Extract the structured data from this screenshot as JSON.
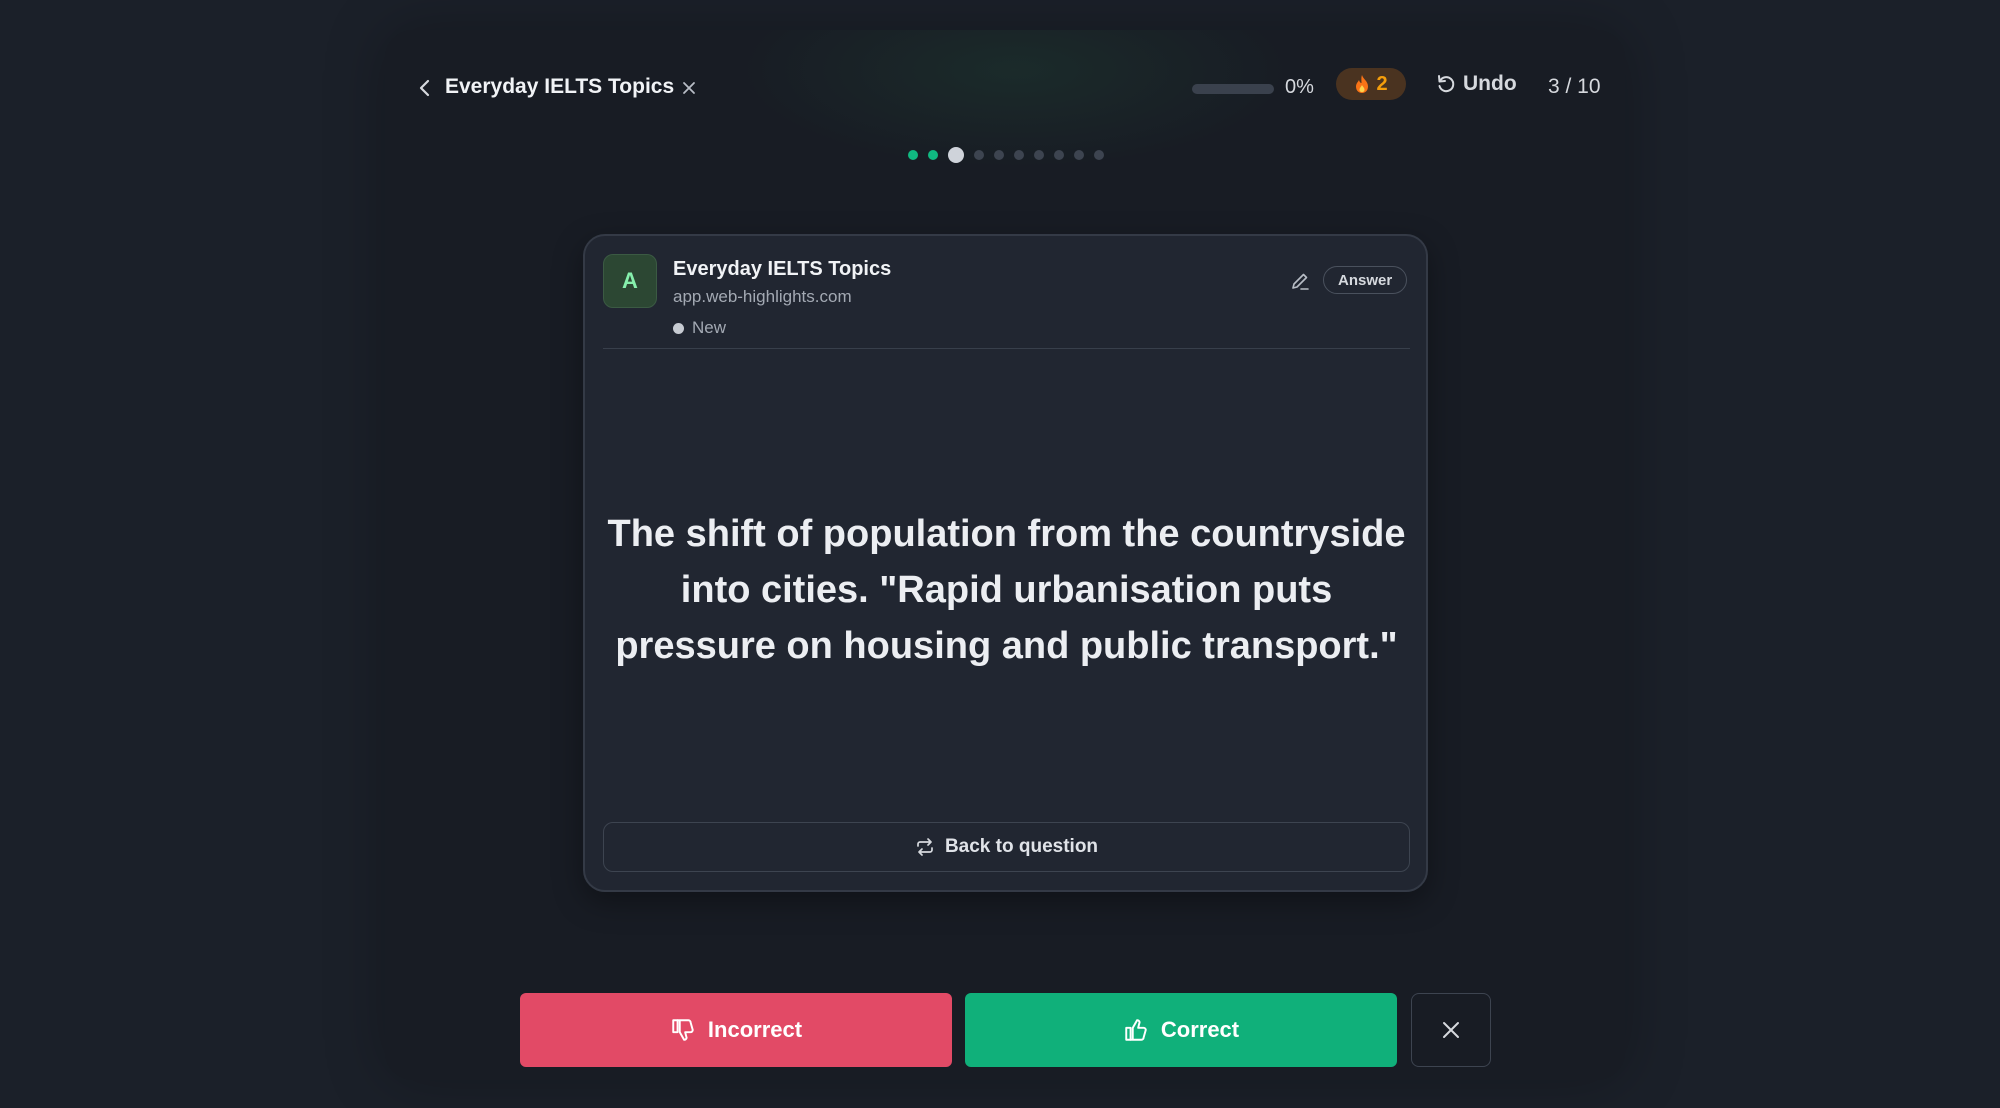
{
  "header": {
    "title": "Everyday IELTS Topics",
    "progress_value": 0,
    "progress_label": "0%",
    "streak_count": "2",
    "undo_label": "Undo",
    "counter": "3 / 10"
  },
  "progress_dots": {
    "total": 10,
    "done": 2,
    "current_index": 2
  },
  "card": {
    "avatar_letter": "A",
    "source_title": "Everyday IELTS Topics",
    "source_url": "app.web-highlights.com",
    "status": "New",
    "side_badge": "Answer",
    "text": "The shift of population from the countryside into cities. \"Rapid urbanisation puts pressure on housing and public transport.\"",
    "flip_label": "Back to question"
  },
  "actions": {
    "incorrect_label": "Incorrect",
    "correct_label": "Correct"
  },
  "colors": {
    "incorrect": "#e24a66",
    "correct": "#10b07a",
    "progress_accent": "#10b981",
    "streak": "#f59e0b"
  },
  "icons": [
    "chevron-left-icon",
    "close-icon",
    "flame-icon",
    "undo-icon",
    "pencil-icon",
    "repeat-icon",
    "thumbs-down-icon",
    "thumbs-up-icon"
  ]
}
